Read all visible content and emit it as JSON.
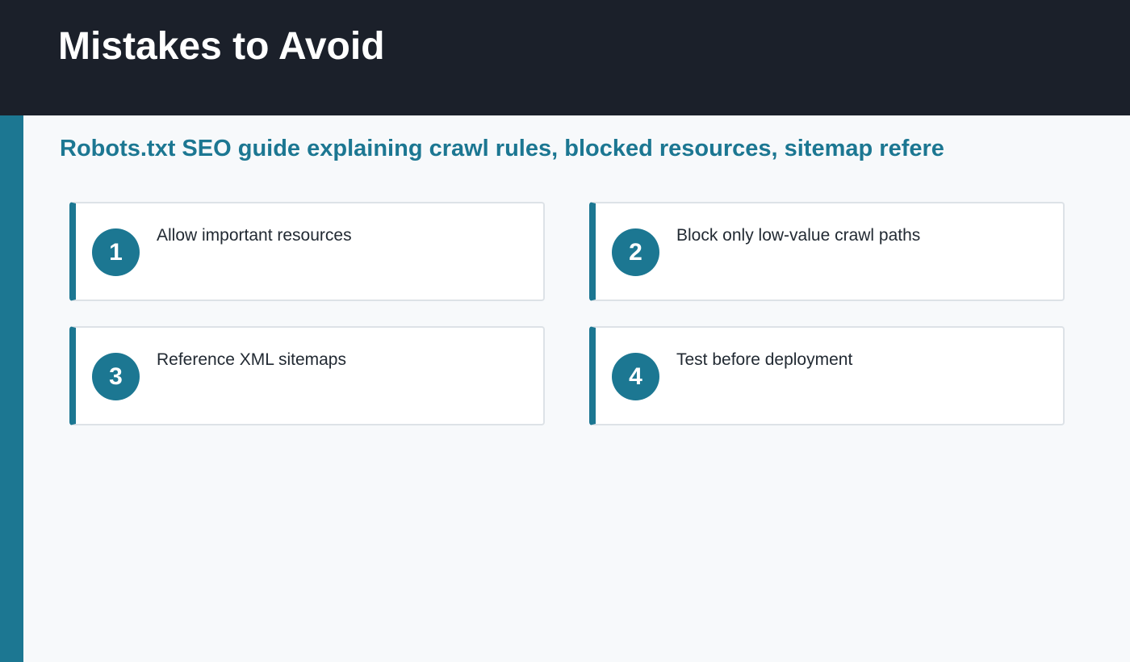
{
  "header": {
    "title": "Mistakes to Avoid"
  },
  "subtitle": "Robots.txt SEO guide explaining crawl rules, blocked resources, sitemap refere",
  "colors": {
    "accent": "#1c7792",
    "header_bg": "#1b202a",
    "page_bg": "#f7f9fb",
    "card_bg": "#ffffff",
    "card_border": "#dde2e7",
    "text": "#222a33"
  },
  "items": [
    {
      "number": "1",
      "label": "Allow important resources"
    },
    {
      "number": "2",
      "label": "Block only low-value crawl paths"
    },
    {
      "number": "3",
      "label": "Reference XML sitemaps"
    },
    {
      "number": "4",
      "label": "Test before deployment"
    }
  ]
}
